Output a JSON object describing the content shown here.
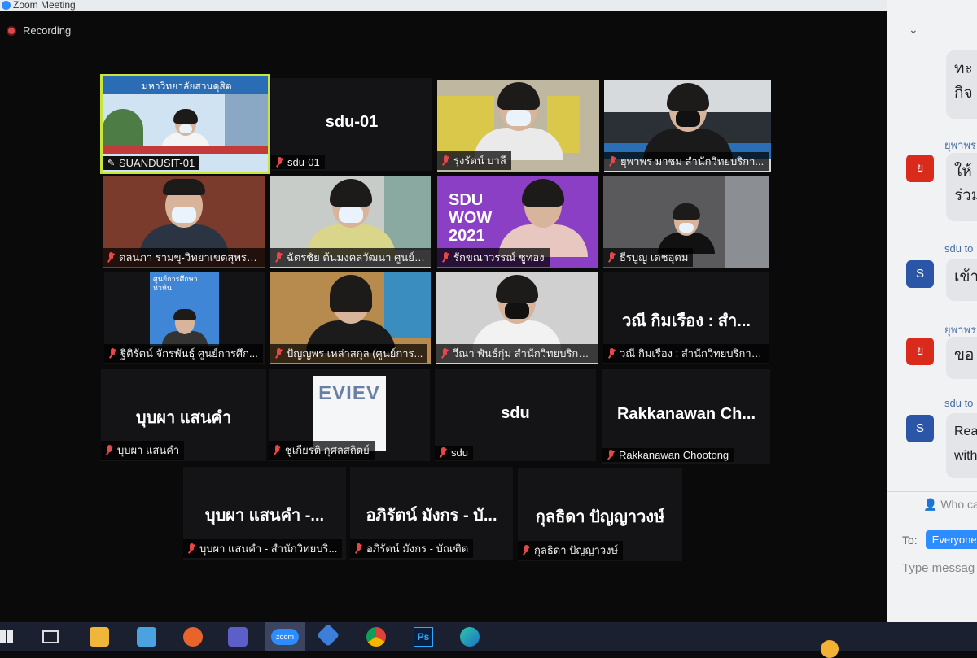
{
  "window": {
    "title": "Zoom Meeting"
  },
  "recording": {
    "label": "Recording"
  },
  "tiles": [
    {
      "id": "suandusit",
      "label": "SUANDUSIT-01",
      "video": true,
      "active": true
    },
    {
      "id": "sdu01",
      "label": "sdu-01",
      "bigname": "sdu-01",
      "video": false
    },
    {
      "id": "rungrat",
      "label": "รุ่งรัตน์ บาลี",
      "video": true
    },
    {
      "id": "yupaporn",
      "label": "ยุพาพร มาชม สำนักวิทยบริกา...",
      "video": true
    },
    {
      "id": "donnapa",
      "label": "ดลนภา รามขุ-วิทยาเขตสุพรร...",
      "video": true
    },
    {
      "id": "chatchai",
      "label": "ฉัตรชัย ต้นมงคลวัฒนา ศูนย์ก...",
      "video": true
    },
    {
      "id": "rakkanwan",
      "label": "รักขณาวรรณ์ ชูทอง",
      "video": true
    },
    {
      "id": "teerabun",
      "label": "ธีรบูญ เดชอุดม",
      "video": true
    },
    {
      "id": "thitirat",
      "label": "ฐิติรัตน์ จักรพันธุ์ ศูนย์การศึก...",
      "video": true
    },
    {
      "id": "panyaporn",
      "label": "ปัญญพร เหล่าสกุล (ศูนย์การ...",
      "video": true
    },
    {
      "id": "weena",
      "label": "วีณา พันธ์กุ่ม สำนักวิทยบริกา...",
      "video": true
    },
    {
      "id": "wanee",
      "label": "วณี กิมเรือง : สำนักวิทยบริการ...",
      "bigname": "วณี กิมเรือง : สำ...",
      "video": false
    },
    {
      "id": "bupa1",
      "label": "บุบผา แสนคำ",
      "bigname": "บุบผา แสนคำ",
      "video": false
    },
    {
      "id": "chukiat",
      "label": "ชูเกียรติ กุศลสถิตย์",
      "video": true,
      "screen_text": "EVIEV"
    },
    {
      "id": "sdu",
      "label": "sdu",
      "bigname": "sdu",
      "video": false
    },
    {
      "id": "rakkanawan",
      "label": "Rakkanawan Chootong",
      "bigname": "Rakkanawan  Ch...",
      "video": false
    },
    {
      "id": "bupa2",
      "label": "บุบผา แสนคำ - สำนักวิทยบริ...",
      "bigname": "บุบผา แสนคำ -...",
      "video": false
    },
    {
      "id": "apirat",
      "label": "อภิรัตน์ มังกร - บัณฑิต",
      "bigname": "อภิรัตน์ มังกร - บั...",
      "video": false
    },
    {
      "id": "kultida",
      "label": "กุลธิดา ปัญญาวงษ์",
      "bigname": "กุลธิดา ปัญญาวงษ์",
      "video": false
    }
  ],
  "video_texts": {
    "suandusit_banner": "มหาวิทยาลัยสวนดุสิต",
    "sdu_wow": "SDU WOW 2021",
    "hua_hin": "ศูนย์การศึกษา หัวหิน"
  },
  "chat": {
    "messages": [
      {
        "sender": "",
        "text": "ทะ กิจ",
        "avatar": ""
      },
      {
        "sender": "ยุพาพร",
        "text": "ให้ ร่วม",
        "avatar": "ย",
        "avatar_color": "#d92a1c"
      },
      {
        "sender": "sdu to",
        "text": "เข้า",
        "avatar": "S",
        "avatar_color": "#2b55a7"
      },
      {
        "sender": "ยุพาพร",
        "text": "ขอ",
        "avatar": "ย",
        "avatar_color": "#d92a1c"
      },
      {
        "sender": "sdu to",
        "text": "Rea with",
        "avatar": "S",
        "avatar_color": "#2b55a7"
      }
    ],
    "who_can": "Who ca",
    "to_label": "To:",
    "to_value": "Everyone",
    "input_placeholder": "Type messag"
  },
  "taskbar": {
    "apps": [
      "windows-icon",
      "task-view-icon",
      "file-explorer-icon",
      "calendar-icon",
      "firefox-icon",
      "teams-icon",
      "zoom-icon",
      "vscode-icon",
      "chrome-icon",
      "photoshop-icon",
      "edge-icon"
    ],
    "zoom_label": "zoom",
    "ps_label": "Ps"
  }
}
